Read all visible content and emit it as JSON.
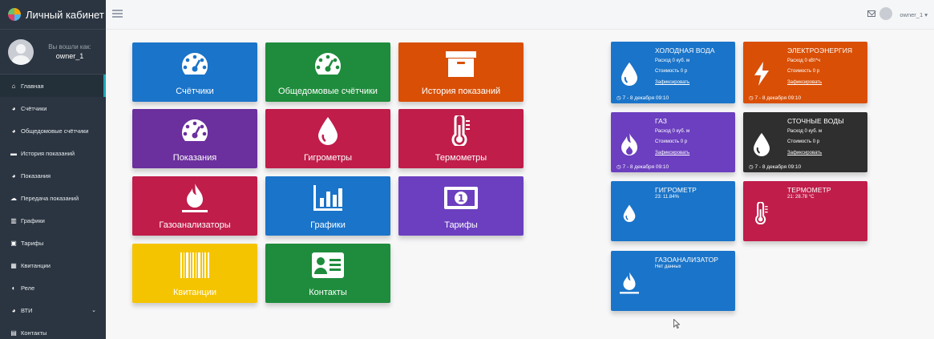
{
  "app": {
    "title": "Личный кабинет"
  },
  "user": {
    "logged_in_as": "Вы вошли как:",
    "name": "owner_1",
    "top_name": "owner_1 ▾"
  },
  "sidebar": {
    "items": [
      {
        "label": "Главная",
        "icon": "home-icon",
        "active": true
      },
      {
        "label": "Счётчики",
        "icon": "gauge-icon"
      },
      {
        "label": "Общедомовые счётчики",
        "icon": "gauge-icon"
      },
      {
        "label": "История показаний",
        "icon": "archive-icon"
      },
      {
        "label": "Показания",
        "icon": "gauge-icon"
      },
      {
        "label": "Передача показаний",
        "icon": "cloud-upload-icon"
      },
      {
        "label": "Графики",
        "icon": "chart-icon"
      },
      {
        "label": "Тарифы",
        "icon": "money-icon"
      },
      {
        "label": "Квитанции",
        "icon": "barcode-icon"
      },
      {
        "label": "Реле",
        "icon": "toggle-icon"
      },
      {
        "label": "ВТИ",
        "icon": "gauge-icon",
        "chevron": "⌄"
      },
      {
        "label": "Контакты",
        "icon": "contact-icon"
      }
    ]
  },
  "tiles": [
    {
      "label": "Счётчики",
      "color": "#1a74c9",
      "icon": "gauge"
    },
    {
      "label": "Общедомовые счётчики",
      "color": "#1e8c3c",
      "icon": "gauge"
    },
    {
      "label": "История показаний",
      "color": "#d94f06",
      "icon": "archive"
    },
    {
      "label": "Показания",
      "color": "#6b2f9e",
      "icon": "gauge"
    },
    {
      "label": "Гигрометры",
      "color": "#c01d4a",
      "icon": "drop"
    },
    {
      "label": "Термометры",
      "color": "#c01d4a",
      "icon": "thermo"
    },
    {
      "label": "Газоанализаторы",
      "color": "#c01d4a",
      "icon": "flame"
    },
    {
      "label": "Графики",
      "color": "#1a74c9",
      "icon": "chart"
    },
    {
      "label": "Тарифы",
      "color": "#6b3fbf",
      "icon": "money"
    },
    {
      "label": "Квитанции",
      "color": "#f5c400",
      "icon": "barcode"
    },
    {
      "label": "Контакты",
      "color": "#1e8c3c",
      "icon": "contact"
    }
  ],
  "info_cards": {
    "cold_water": {
      "title": "ХОЛОДНАЯ ВОДА",
      "usage": "Расход  0 куб. м",
      "cost": "Стоимость  0 р",
      "link": "Зафиксировать",
      "foot": "◷ 7 - 8 декабря 09:10",
      "color": "#1a74c9"
    },
    "electricity": {
      "title": "ЭЛЕКТРОЭНЕРГИЯ",
      "usage": "Расход  0 кВт*ч",
      "cost": "Стоимость  0 р",
      "link": "Зафиксировать",
      "foot": "◷ 7 - 8 декабря 09:10",
      "color": "#d94f06"
    },
    "gas": {
      "title": "ГАЗ",
      "usage": "Расход  0 куб. м",
      "cost": "Стоимость  0 р",
      "link": "Зафиксировать",
      "foot": "◷ 7 - 8 декабря 09:10",
      "color": "#6b3fbf"
    },
    "sewage": {
      "title": "СТОЧНЫЕ ВОДЫ",
      "usage": "Расход  0 куб. м",
      "cost": "Стоимость  0 р",
      "link": "Зафиксировать",
      "foot": "◷ 7 - 8 декабря 09:10",
      "color": "#2f2f30"
    },
    "hygrometer": {
      "title": "ГИГРОМЕТР",
      "value": "23: 11.84%",
      "color": "#1a74c9"
    },
    "thermometer": {
      "title": "ТЕРМОМЕТР",
      "value": "21: 28.78 °C",
      "color": "#c01d4a"
    },
    "gas_analyzer": {
      "title": "ГАЗОАНАЛИЗАТОР",
      "value": "Нет данных",
      "color": "#1a74c9"
    }
  }
}
